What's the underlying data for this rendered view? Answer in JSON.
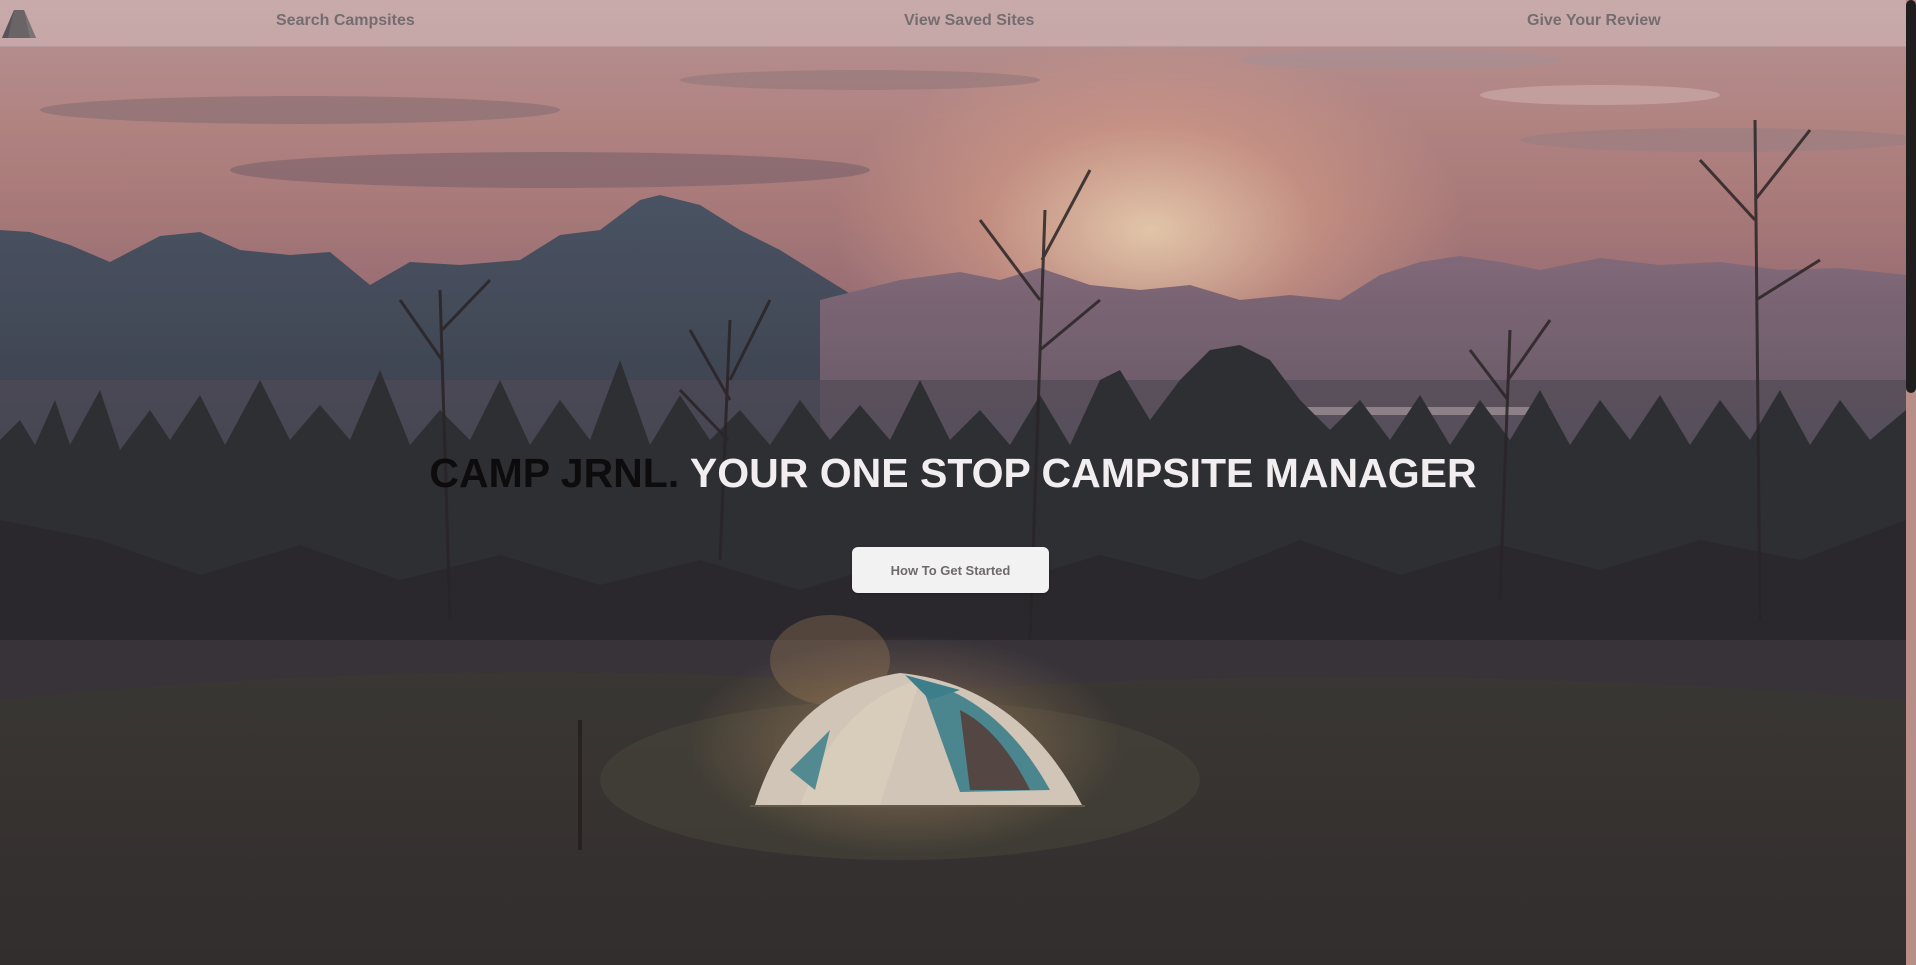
{
  "nav": {
    "logo_icon": "tent-logo-icon",
    "links": [
      {
        "label": "Search Campsites"
      },
      {
        "label": "View Saved Sites"
      },
      {
        "label": "Give Your Review"
      }
    ]
  },
  "hero": {
    "brand": "CAMP JRNL.",
    "tagline": "YOUR ONE STOP CAMPSITE MANAGER",
    "cta_label": "How To Get Started"
  },
  "colors": {
    "brand_text": "#0d0b0c",
    "tagline_text": "#f2eeef",
    "nav_text": "#746d70",
    "cta_bg": "#f3f2f2"
  }
}
